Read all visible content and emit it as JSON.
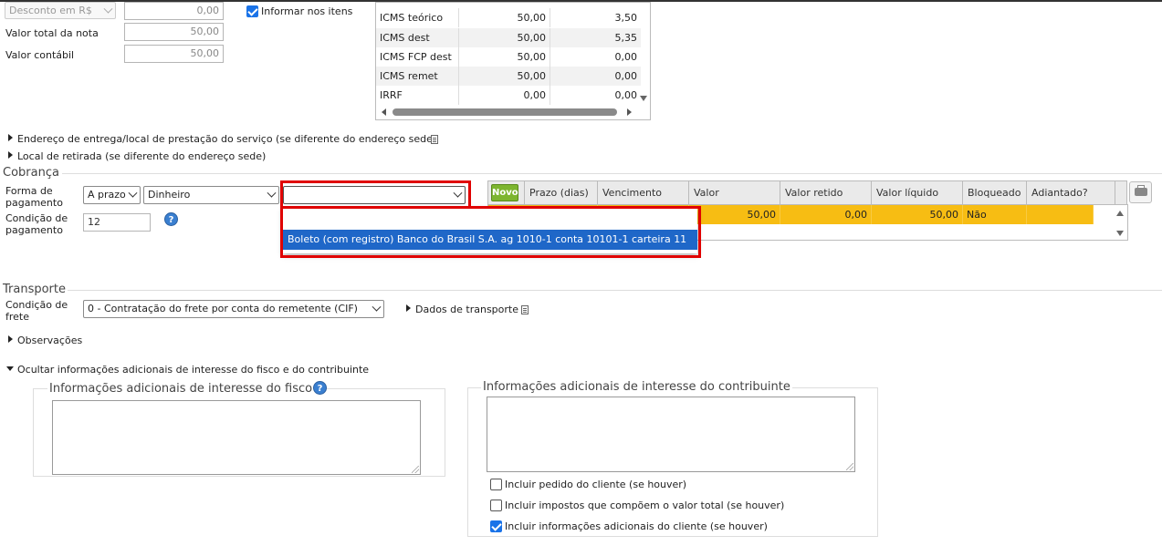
{
  "totals": {
    "desconto_select": "Desconto em R$",
    "desconto_value": "0,00",
    "informar_itens_label": "Informar nos itens",
    "informar_itens_checked": true,
    "valor_total_label": "Valor total da nota",
    "valor_total_value": "50,00",
    "valor_contabil_label": "Valor contábil",
    "valor_contabil_value": "50,00"
  },
  "taxes": [
    {
      "name": "ICMS teórico",
      "base": "50,00",
      "value": "3,50"
    },
    {
      "name": "ICMS dest",
      "base": "50,00",
      "value": "5,35"
    },
    {
      "name": "ICMS FCP dest",
      "base": "50,00",
      "value": "0,00"
    },
    {
      "name": "ICMS remet",
      "base": "50,00",
      "value": "0,00"
    },
    {
      "name": "IRRF",
      "base": "0,00",
      "value": "0,00"
    }
  ],
  "links": {
    "endereco_entrega": "Endereço de entrega/local de prestação do serviço (se diferente do endereço sede)",
    "local_retirada": "Local de retirada (se diferente do endereço sede)"
  },
  "cobranca": {
    "title": "Cobrança",
    "forma_label": "Forma de pagamento",
    "forma_tipo": "A prazo",
    "forma_meio": "Dinheiro",
    "forma_conta": "",
    "condicao_label": "Condição de pagamento",
    "condicao_value": "12",
    "dropdown_options": [
      "",
      "Boleto (com registro) Banco do Brasil S.A. ag 1010-1 conta 10101-1 carteira 11"
    ],
    "novo_label": "Novo",
    "grid_headers": [
      "Prazo (dias)",
      "Vencimento",
      "Valor",
      "Valor retido",
      "Valor líquido",
      "Bloqueado",
      "Adiantado?"
    ],
    "grid_row": {
      "prazo": "",
      "vencimento": "",
      "valor": "50,00",
      "retido": "0,00",
      "liquido": "50,00",
      "bloqueado": "Não",
      "adiantado": ""
    }
  },
  "transporte": {
    "title": "Transporte",
    "condicao_label": "Condição de frete",
    "condicao_value": "0 - Contratação do frete por conta do remetente (CIF)",
    "dados_label": "Dados de transporte"
  },
  "observacoes_label": "Observações",
  "info_adicionais": {
    "toggle_label": "Ocultar informações adicionais de interesse do fisco e do contribuinte",
    "fisco_title": "Informações adicionais de interesse do fisco",
    "contribuinte_title": "Informações adicionais de interesse do contribuinte",
    "checkboxes": [
      {
        "label": "Incluir pedido do cliente (se houver)",
        "checked": false
      },
      {
        "label": "Incluir impostos que compõem o valor total (se houver)",
        "checked": false
      },
      {
        "label": "Incluir informações adicionais do cliente (se houver)",
        "checked": true
      }
    ]
  },
  "colors": {
    "accent": "#1f67c8",
    "highlight_row": "#f7bd13",
    "novo": "#7db52f",
    "annotation": "#e00000"
  }
}
